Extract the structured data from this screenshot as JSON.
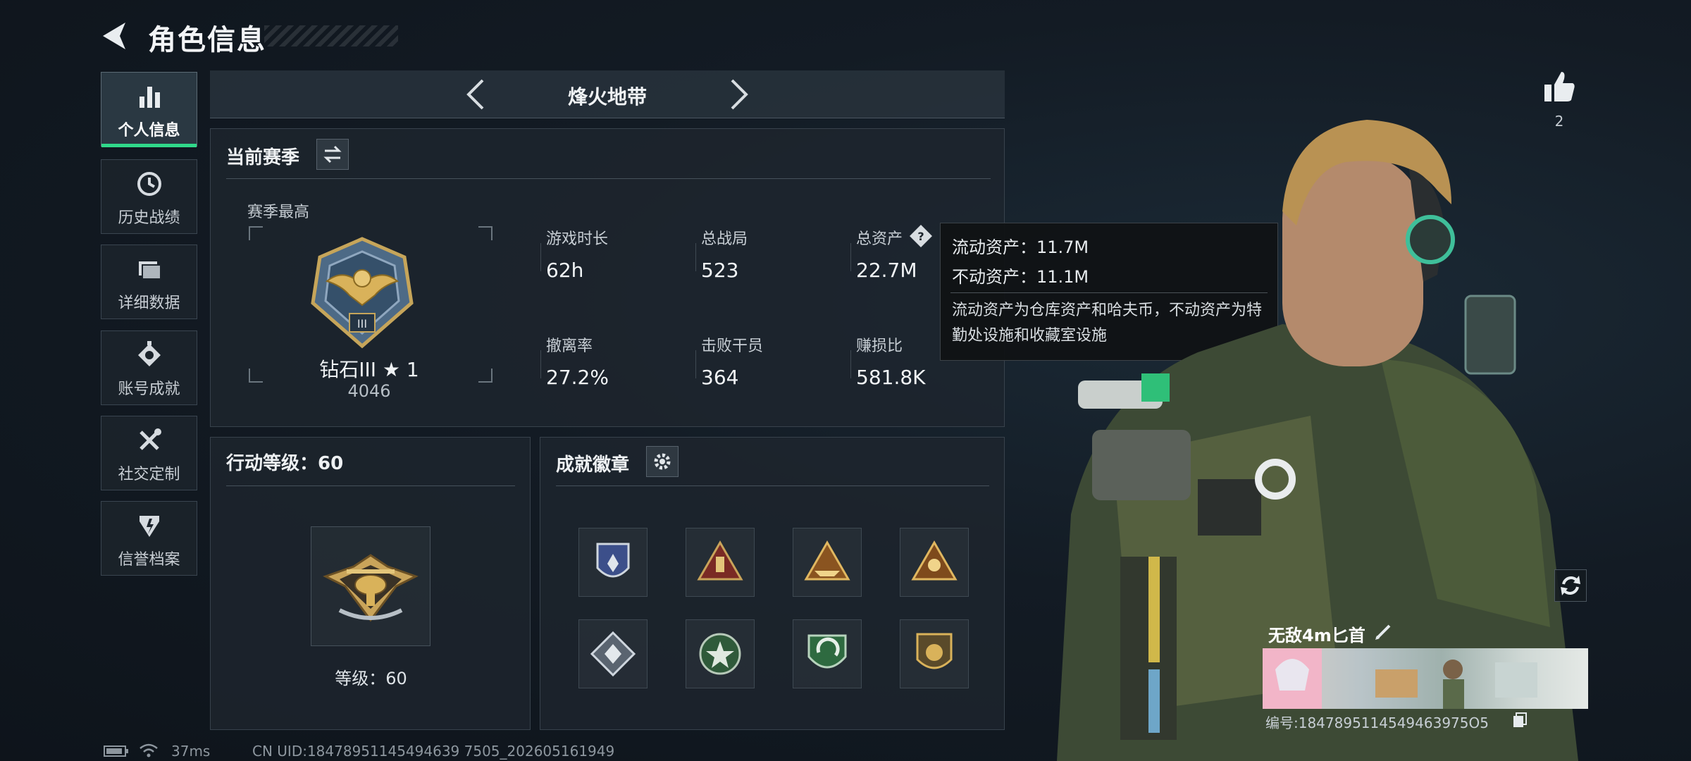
{
  "header": {
    "title": "角色信息"
  },
  "sidebar": {
    "items": [
      {
        "label": "个人信息",
        "icon": "bar-chart-icon",
        "active": true
      },
      {
        "label": "历史战绩",
        "icon": "history-clock-icon",
        "active": false
      },
      {
        "label": "详细数据",
        "icon": "folder-icon",
        "active": false
      },
      {
        "label": "账号成就",
        "icon": "medal-icon",
        "active": false
      },
      {
        "label": "社交定制",
        "icon": "tools-icon",
        "active": false
      },
      {
        "label": "信誉档案",
        "icon": "shield-icon",
        "active": false
      }
    ]
  },
  "map_selector": {
    "current": "烽火地带"
  },
  "season": {
    "title": "当前赛季",
    "best_label": "赛季最高",
    "rank_name": "钻石III ★ 1",
    "rank_points": "4046",
    "stats": [
      {
        "label": "游戏时长",
        "value": "62h"
      },
      {
        "label": "总战局",
        "value": "523"
      },
      {
        "label": "总资产",
        "value": "22.7M"
      },
      {
        "label": "撤离率",
        "value": "27.2%"
      },
      {
        "label": "击败干员",
        "value": "364"
      },
      {
        "label": "赚损比",
        "value": "581.8K"
      }
    ]
  },
  "tooltip": {
    "liquid": "流动资产：11.7M",
    "fixed": "不动资产：11.1M",
    "description": "流动资产为仓库资产和哈夫币，不动资产为特勤处设施和收藏室设施"
  },
  "action_level": {
    "title": "行动等级：60",
    "caption": "等级：60"
  },
  "achievements": {
    "title": "成就徽章",
    "badges": [
      "police-badge-icon",
      "hand-sign-triangle-icon",
      "boat-triangle-icon",
      "fighter-triangle-icon",
      "crystal-diamond-icon",
      "star-gear-icon",
      "arrows-shield-icon",
      "coin-shield-icon"
    ]
  },
  "likes": {
    "count": "2"
  },
  "player_card": {
    "name": "无敌4m匕首",
    "id_text": "编号:1847895114549463975O5"
  },
  "status": {
    "ping": "37ms",
    "uid": "CN UID:18478951145494639 7505_202605161949"
  },
  "colors": {
    "accent": "#30d98a",
    "panel": "#1e262e",
    "gold": "#d9b25a"
  }
}
